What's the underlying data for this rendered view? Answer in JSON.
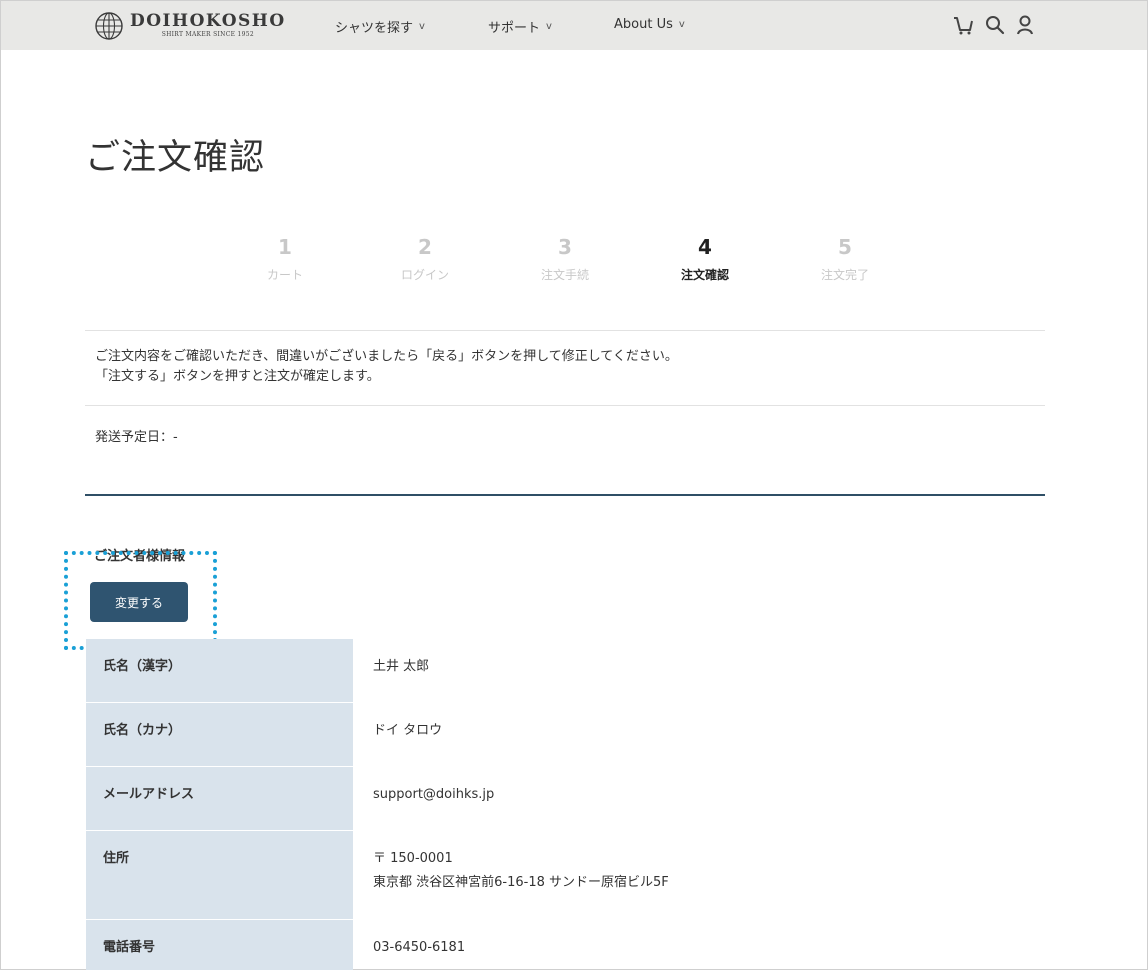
{
  "header": {
    "logo_name": "DOIHOKOSHO",
    "logo_sub": "SHIRT MAKER SINCE 1952",
    "nav": [
      {
        "label": "シャツを探す",
        "chevron": "v"
      },
      {
        "label": "サポート",
        "chevron": "v"
      },
      {
        "label": "About Us",
        "chevron": "v"
      }
    ],
    "icons": [
      "cart-icon",
      "search-icon",
      "user-icon"
    ]
  },
  "page_title": "ご注文確認",
  "steps": [
    {
      "num": "1",
      "label": "カート"
    },
    {
      "num": "2",
      "label": "ログイン"
    },
    {
      "num": "3",
      "label": "注文手続"
    },
    {
      "num": "4",
      "label": "注文確認"
    },
    {
      "num": "5",
      "label": "注文完了"
    }
  ],
  "active_step": 4,
  "message": {
    "line1": "ご注文内容をご確認いただき、間違いがございましたら「戻る」ボタンを押して修正してください。",
    "line2": "「注文する」ボタンを押すと注文が確定します。"
  },
  "shipping": {
    "label": "発送予定日：-"
  },
  "customer": {
    "section_title": "ご注文者様情報",
    "change_label": "変更する",
    "rows": [
      {
        "key": "氏名（漢字）",
        "value": "土井 太郎"
      },
      {
        "key": "氏名（カナ）",
        "value": "ドイ タロウ"
      },
      {
        "key": "メールアドレス",
        "value": "support@doihks.jp"
      },
      {
        "key": "住所",
        "value": "〒 150-0001",
        "value2": "東京都 渋谷区神宮前6-16-18 サンドー原宿ビル5F"
      },
      {
        "key": "電話番号",
        "value": "03-6450-6181"
      }
    ]
  },
  "colors": {
    "header_bg": "#e8e8e6",
    "button_bg": "#2f5470",
    "table_key_bg": "#d9e3ec",
    "highlight": "#1aa0d6"
  }
}
